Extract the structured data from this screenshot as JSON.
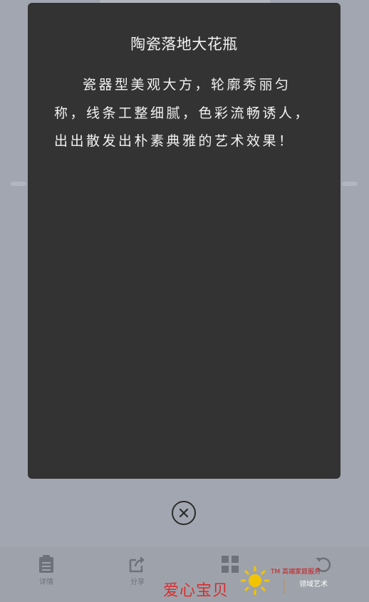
{
  "modal": {
    "title": "陶瓷落地大花瓶",
    "description": "瓷器型美观大方，轮廓秀丽匀称，线条工整细腻，色彩流畅诱人，出出散发出朴素典雅的艺术效果！"
  },
  "close_button": {
    "icon": "close-circle-icon"
  },
  "toolbar": {
    "items": [
      {
        "label": "详情",
        "icon": "clipboard-icon"
      },
      {
        "label": "分享",
        "icon": "share-icon"
      },
      {
        "label": "",
        "icon": "grid-icon"
      },
      {
        "label": "",
        "icon": "refresh-icon"
      }
    ]
  },
  "watermark": {
    "text": "爱心宝贝",
    "tm_text": "TM 高端家庭服务",
    "wechat_text": "领域艺术"
  },
  "colors": {
    "modal_bg": "#333333",
    "page_bg": "#a1a6b0",
    "watermark_red": "#e02020"
  }
}
